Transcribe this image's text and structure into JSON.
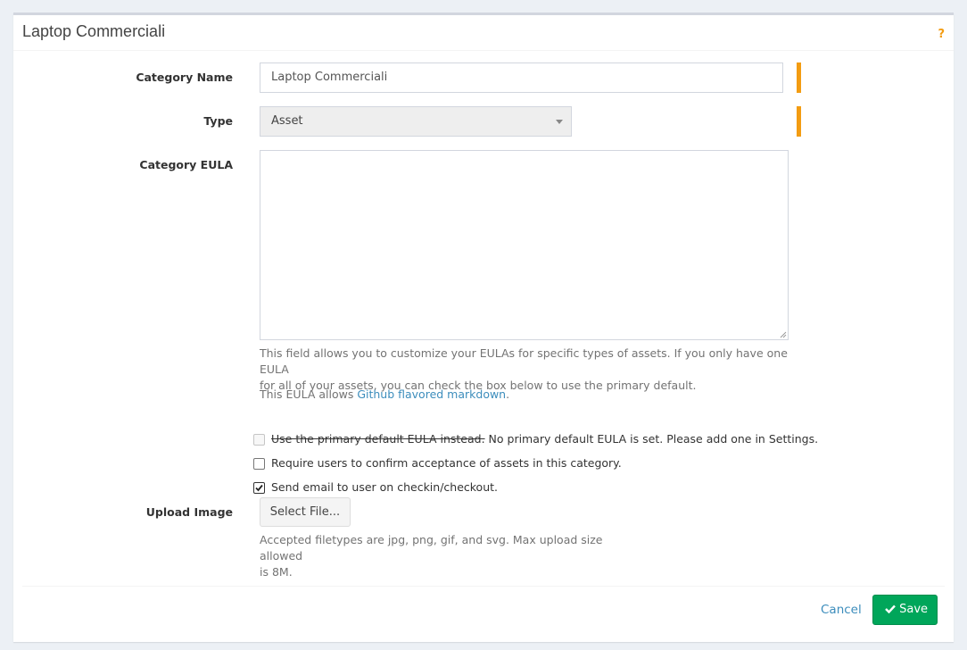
{
  "header": {
    "title": "Laptop Commerciali",
    "help_icon": "question-mark"
  },
  "form": {
    "category_name": {
      "label": "Category Name",
      "value": "Laptop Commerciali"
    },
    "type": {
      "label": "Type",
      "selected": "Asset"
    },
    "eula": {
      "label": "Category EULA",
      "value": "",
      "help_line1": "This field allows you to customize your EULAs for specific types of assets. If you only have one EULA",
      "help_line2": "for all of your assets, you can check the box below to use the primary default.",
      "markdown_prefix": "This EULA allows ",
      "markdown_link": "Github flavored markdown",
      "markdown_suffix": "."
    },
    "checkboxes": [
      {
        "struck_text": "Use the primary default EULA instead.",
        "text": " No primary default EULA is set. Please add one in Settings.",
        "checked": false,
        "disabled": true
      },
      {
        "text": "Require users to confirm acceptance of assets in this category.",
        "checked": false,
        "disabled": false
      },
      {
        "text": "Send email to user on checkin/checkout.",
        "checked": true,
        "disabled": false
      }
    ],
    "upload": {
      "label": "Upload Image",
      "button": "Select File...",
      "help_line1": "Accepted filetypes are jpg, png, gif, and svg. Max upload size allowed",
      "help_line2": "is 8M."
    }
  },
  "footer": {
    "cancel": "Cancel",
    "save": "Save",
    "save_icon": "check"
  },
  "colors": {
    "accent": "#f39c12",
    "link": "#3c8dbc",
    "save": "#00a65a"
  }
}
